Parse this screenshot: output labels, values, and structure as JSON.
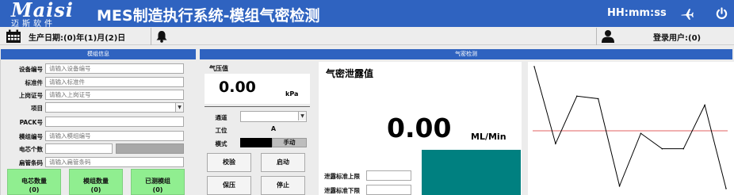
{
  "header": {
    "logo_text": "Maisi",
    "logo_sub": "迈斯软件",
    "title": "MES制造执行系统-模组气密检测",
    "clock": "HH:mm:ss",
    "color": "#2f63c0"
  },
  "infobar": {
    "production_date": "生产日期:(0)年(1)月(2)日",
    "login_user": "登录用户:(0)"
  },
  "module_info": {
    "header": "模组信息",
    "fields": [
      {
        "label": "设备编号",
        "placeholder": "请输入设备编号"
      },
      {
        "label": "标准件",
        "placeholder": "请输入标准件"
      },
      {
        "label": "上岗证号",
        "placeholder": "请输入上岗证号"
      },
      {
        "label": "项目",
        "value": ""
      },
      {
        "label": "PACK号",
        "value": ""
      },
      {
        "label": "模组编号",
        "placeholder": "请输入模组编号"
      },
      {
        "label": "电芯个数",
        "value": ""
      },
      {
        "label": "扁管条码",
        "placeholder": "请输入扁管条码"
      }
    ],
    "stats": [
      {
        "label": "电芯数量",
        "value": "(0)"
      },
      {
        "label": "模组数量",
        "value": "(0)"
      },
      {
        "label": "已测模组",
        "value": "(0)"
      }
    ],
    "stat_color": "#90ee90"
  },
  "leak_test": {
    "header": "气密检测",
    "pressure_label": "气压值",
    "pressure_value": "0.00",
    "pressure_unit": "kPa",
    "channel_label": "通道",
    "station_label": "工位",
    "station_value": "A",
    "mode_label": "模式",
    "mode_value": "手动",
    "buttons": {
      "calibrate": "校验",
      "start": "启动",
      "hold": "保压",
      "stop": "停止"
    },
    "leak_title": "气密泄露值",
    "leak_value": "0.00",
    "leak_unit": "ML/Min",
    "upper_limit_label": "泄露标准上限",
    "lower_limit_label": "泄露标准下限",
    "teal_color": "#008080"
  },
  "chart_data": {
    "type": "line",
    "title": "",
    "xlabel": "",
    "ylabel": "",
    "ylim": [
      0,
      10
    ],
    "x": [
      0,
      1,
      2,
      3,
      4,
      5,
      6,
      7,
      8,
      9
    ],
    "series": [
      {
        "values": [
          10.0,
          4.0,
          7.7,
          7.5,
          0.7,
          4.8,
          3.6,
          3.6,
          7.0,
          0.5
        ]
      }
    ],
    "reference_line": 5.0,
    "reference_color": "#e06060",
    "line_color": "#000000",
    "grid": false
  }
}
